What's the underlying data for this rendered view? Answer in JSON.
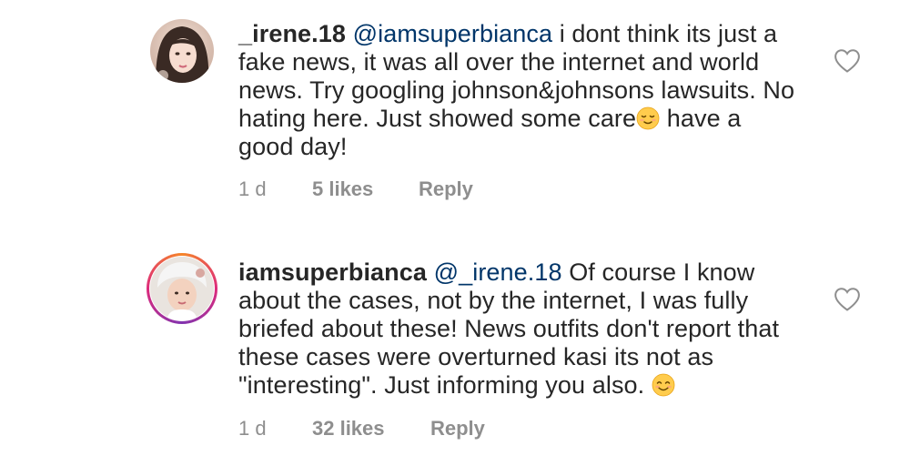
{
  "comments": [
    {
      "username": "_irene.18",
      "mention": "@iamsuperbianca",
      "body_part1": " i dont think its just a fake news, it was all over the internet and world news. Try googling johnson&johnsons lawsuits. No hating here. Just showed some care",
      "body_part2": " have a good day!",
      "emoji": "relieved-face",
      "age": "1 d",
      "likes": "5 likes",
      "reply": "Reply",
      "avatar_icon": "profile-photo",
      "like_icon": "heart-outline-icon"
    },
    {
      "username": "iamsuperbianca",
      "mention": "@_irene.18",
      "body_part1": " Of course I know about the cases, not by the internet, I was fully briefed about these! News outfits don't report that these cases were overturned kasi its not as \"interesting\". Just informing you also. ",
      "body_part2": "",
      "emoji": "smiling-face",
      "age": "1 d",
      "likes": "32 likes",
      "reply": "Reply",
      "avatar_icon": "profile-photo-with-story-ring",
      "like_icon": "heart-outline-icon"
    }
  ],
  "colors": {
    "text": "#262626",
    "mention": "#003569",
    "meta": "#8e8e8e",
    "heart_stroke": "#8e8e8e"
  }
}
